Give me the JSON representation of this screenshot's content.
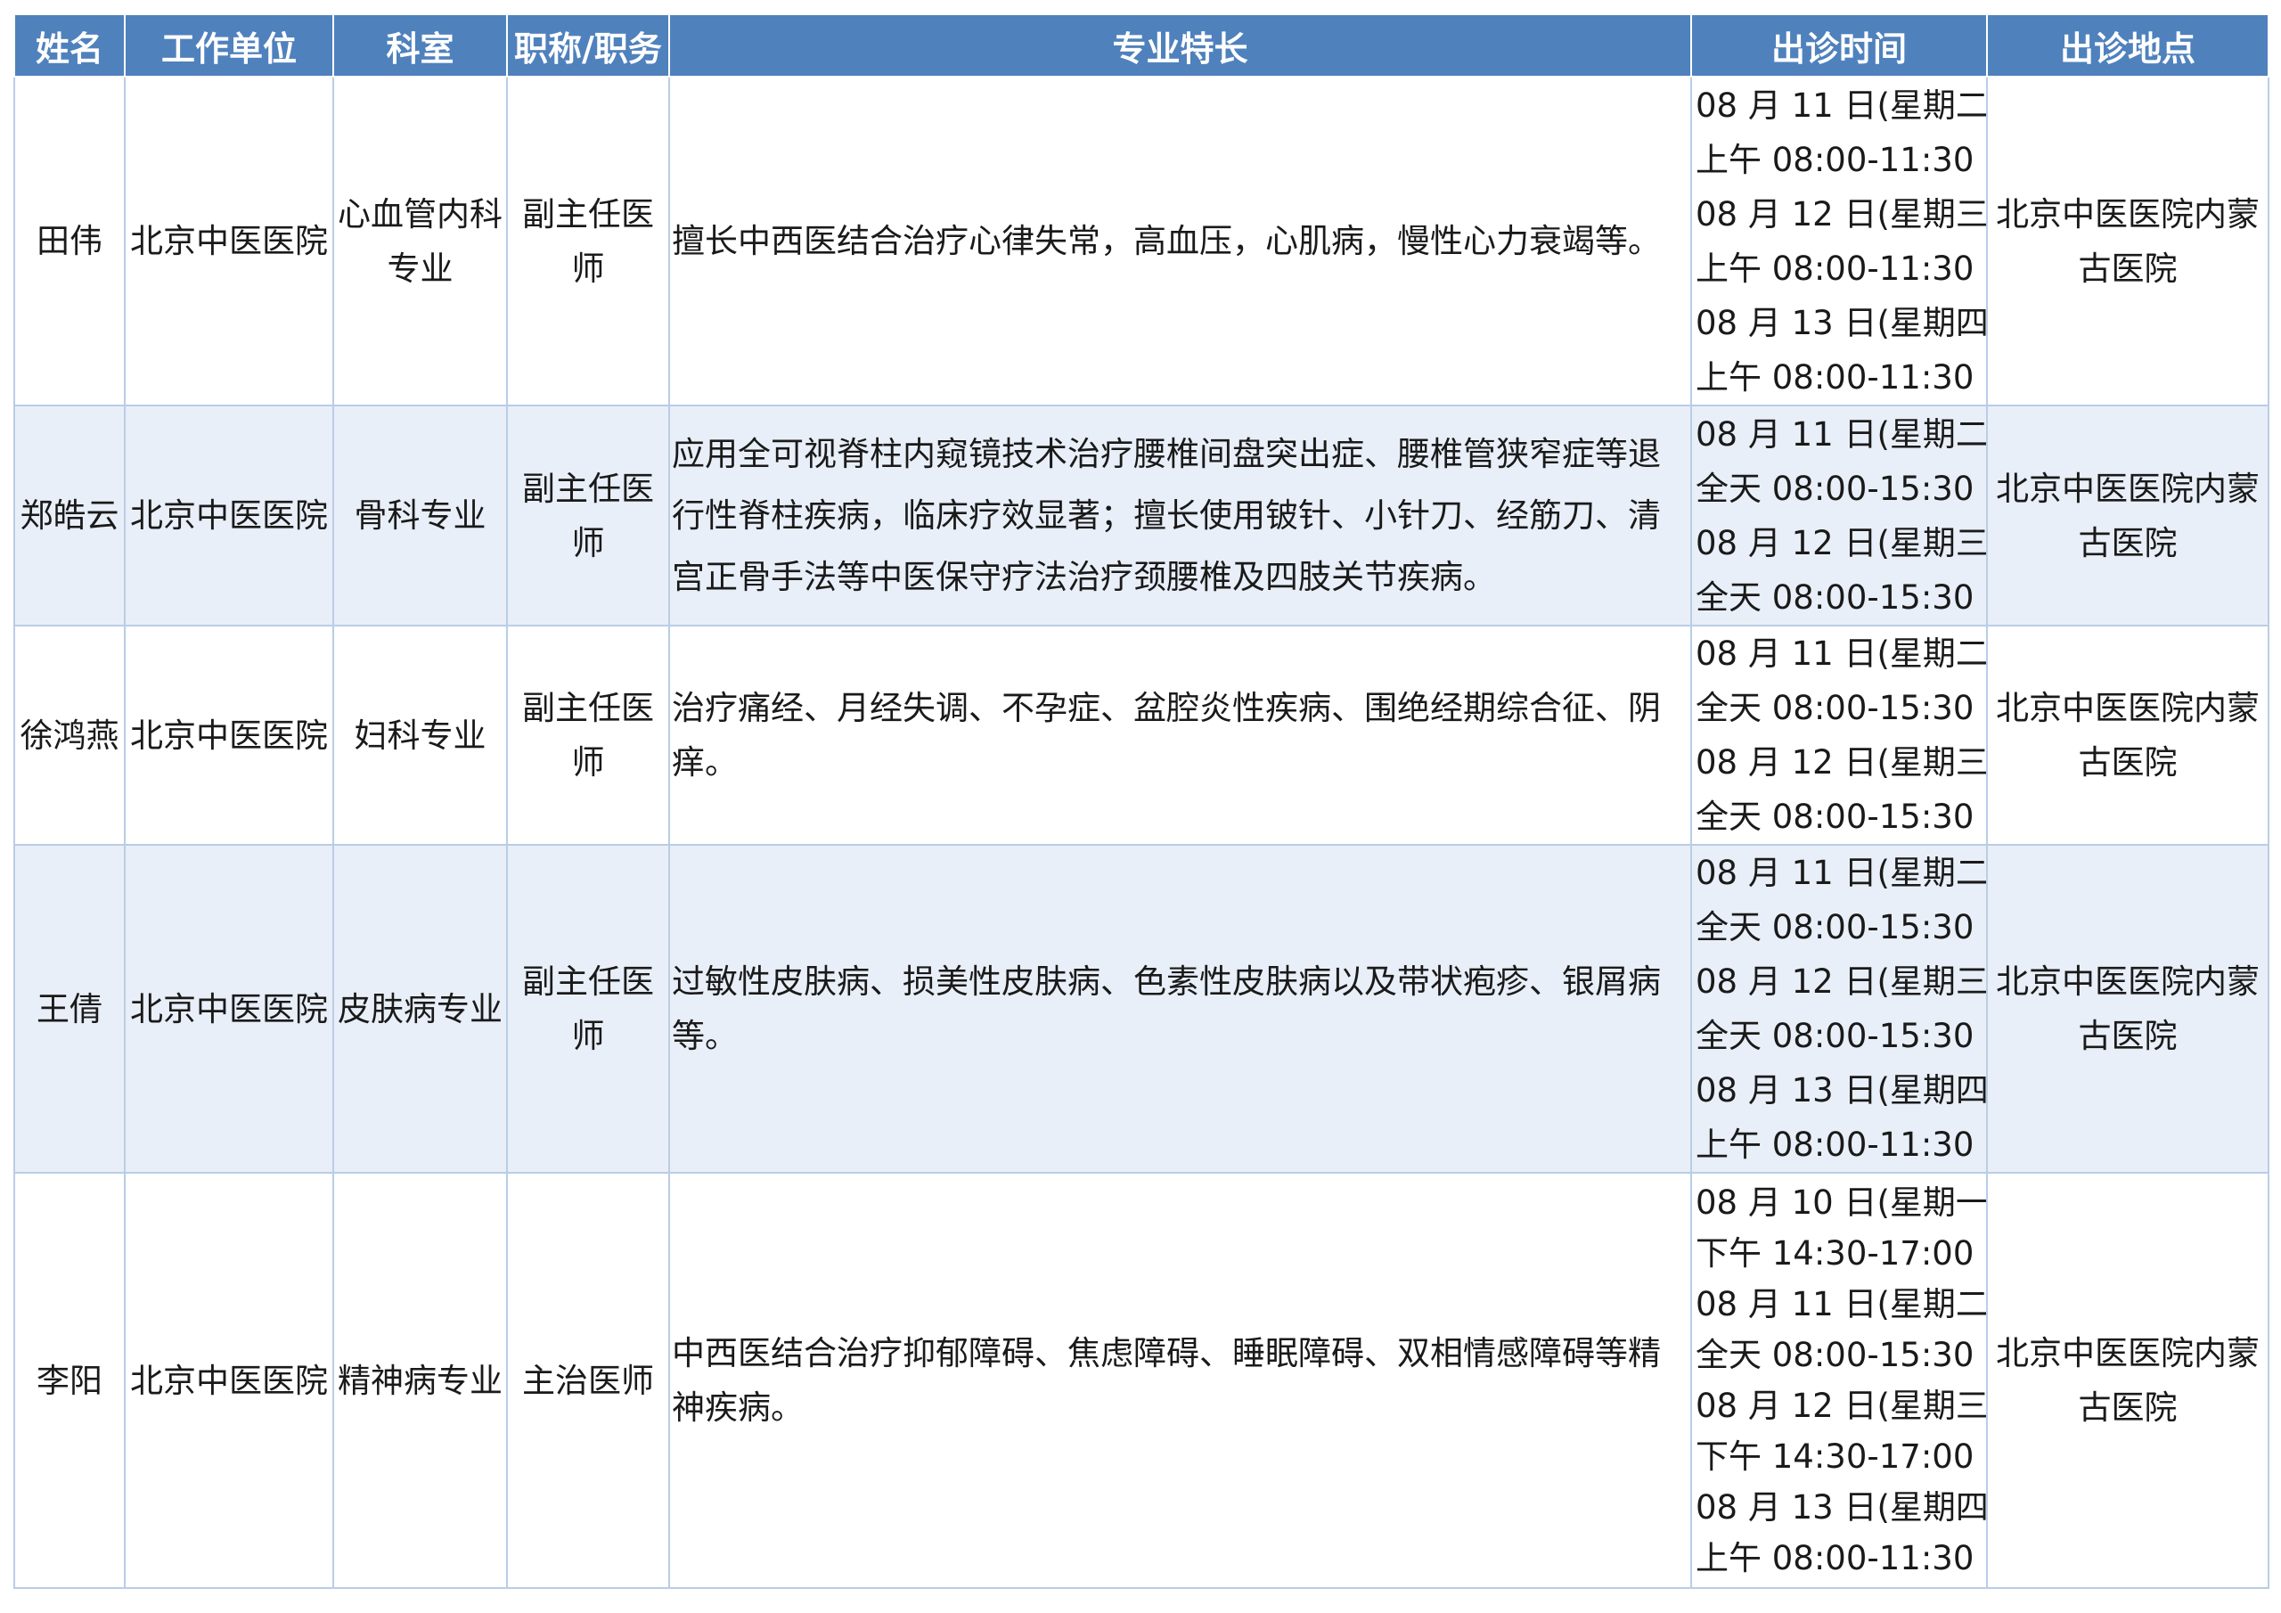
{
  "headers": {
    "name": "姓名",
    "unit": "工作单位",
    "dept": "科室",
    "title": "职称/职务",
    "specialty": "专业特长",
    "time": "出诊时间",
    "place": "出诊地点"
  },
  "rows": [
    {
      "name": "田伟",
      "unit": "北京中医医院",
      "dept": "心血管内科专业",
      "title": "副主任医师",
      "specialty": "擅长中西医结合治疗心律失常，高血压，心肌病，慢性心力衰竭等。",
      "schedule": [
        "08 月 11 日(星期二)",
        "上午 08:00-11:30",
        "08 月 12 日(星期三)",
        "上午 08:00-11:30",
        "08 月 13 日(星期四)",
        "上午 08:00-11:30"
      ],
      "place": "北京中医医院内蒙古医院"
    },
    {
      "name": "郑皓云",
      "unit": "北京中医医院",
      "dept": "骨科专业",
      "title": "副主任医师",
      "specialty": "应用全可视脊柱内窥镜技术治疗腰椎间盘突出症、腰椎管狭窄症等退行性脊柱疾病，临床疗效显著；擅长使用铍针、小针刀、经筋刀、清宫正骨手法等中医保守疗法治疗颈腰椎及四肢关节疾病。",
      "schedule": [
        "08 月 11 日(星期二)",
        "全天 08:00-15:30",
        "08 月 12 日(星期三)",
        "全天 08:00-15:30"
      ],
      "place": "北京中医医院内蒙古医院"
    },
    {
      "name": "徐鸿燕",
      "unit": "北京中医医院",
      "dept": "妇科专业",
      "title": "副主任医师",
      "specialty": "治疗痛经、月经失调、不孕症、盆腔炎性疾病、围绝经期综合征、阴痒。",
      "schedule": [
        "08 月 11 日(星期二)",
        "全天 08:00-15:30",
        "08 月 12 日(星期三)",
        "全天 08:00-15:30"
      ],
      "place": "北京中医医院内蒙古医院"
    },
    {
      "name": "王倩",
      "unit": "北京中医医院",
      "dept": "皮肤病专业",
      "title": "副主任医师",
      "specialty": "过敏性皮肤病、损美性皮肤病、色素性皮肤病以及带状疱疹、银屑病等。",
      "schedule": [
        "08 月 11 日(星期二)",
        "全天 08:00-15:30",
        "08 月 12 日(星期三)",
        "全天 08:00-15:30",
        "08 月 13 日(星期四)",
        "上午 08:00-11:30"
      ],
      "place": "北京中医医院内蒙古医院"
    },
    {
      "name": "李阳",
      "unit": "北京中医医院",
      "dept": "精神病专业",
      "title": "主治医师",
      "specialty": "中西医结合治疗抑郁障碍、焦虑障碍、睡眠障碍、双相情感障碍等精神疾病。",
      "schedule": [
        "08 月 10 日(星期一)",
        "下午 14:30-17:00",
        "08 月 11 日(星期二)",
        "全天 08:00-15:30",
        "08 月 12 日(星期三)",
        "下午 14:30-17:00",
        "08 月 13 日(星期四)",
        "上午 08:00-11:30"
      ],
      "place": "北京中医医院内蒙古医院"
    }
  ]
}
